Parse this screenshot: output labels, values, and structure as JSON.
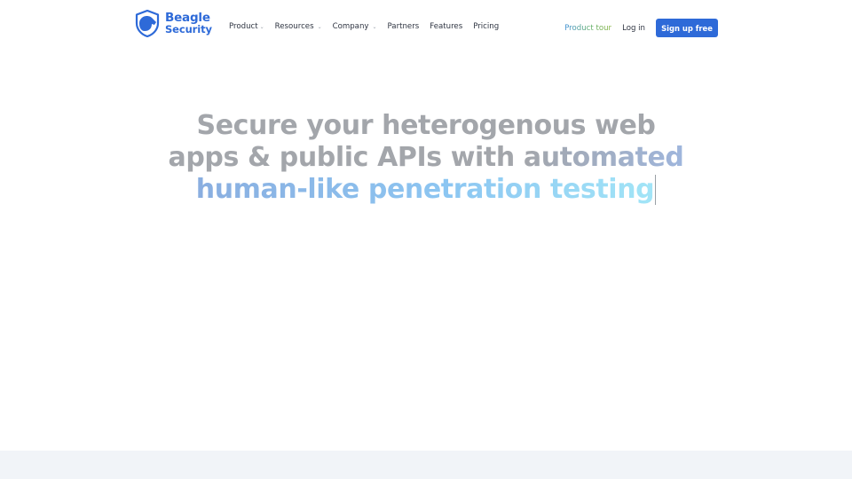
{
  "brand": {
    "name_line1": "Beagle",
    "name_line2": "Security",
    "logo_icon": "beagle-shield-icon",
    "color": "#2e6ad8"
  },
  "nav": {
    "items": [
      {
        "label": "Product",
        "has_dropdown": true,
        "chevron": "⌄"
      },
      {
        "label": "Resources",
        "has_dropdown": true,
        "chevron": "⌄"
      },
      {
        "label": "Company",
        "has_dropdown": true,
        "chevron": "⌄"
      },
      {
        "label": "Partners",
        "has_dropdown": false
      },
      {
        "label": "Features",
        "has_dropdown": false
      },
      {
        "label": "Pricing",
        "has_dropdown": false
      }
    ],
    "product_tour": "Product tour",
    "login": "Log in",
    "signup": "Sign up free"
  },
  "hero": {
    "line1": "Secure your heterogenous web",
    "line2_plain": "apps & public APIs with ",
    "line2_accent": "automated",
    "line3": "human-like penetration testing"
  },
  "colors": {
    "accent": "#2e6ad8",
    "headline_gray": "#a3a6ab",
    "gradient_start": "#8aaee0",
    "gradient_end": "#a2e5f7",
    "footer_band": "#f1f4f8"
  }
}
